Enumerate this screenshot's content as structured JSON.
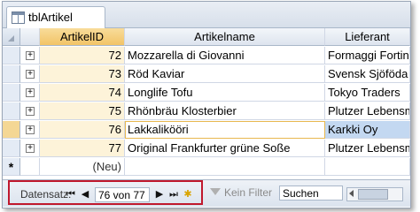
{
  "window": {
    "tab_title": "tblArtikel"
  },
  "columns": {
    "id": "ArtikelID",
    "name": "Artikelname",
    "lief": "Lieferant"
  },
  "rows": [
    {
      "id": "72",
      "name": "Mozzarella di Giovanni",
      "lief": "Formaggi Fortini"
    },
    {
      "id": "73",
      "name": "Röd Kaviar",
      "lief": "Svensk Sjöföda"
    },
    {
      "id": "74",
      "name": "Longlife Tofu",
      "lief": "Tokyo Traders"
    },
    {
      "id": "75",
      "name": "Rhönbräu Klosterbier",
      "lief": "Plutzer Lebensm"
    },
    {
      "id": "76",
      "name": "Lakkalikööri",
      "lief": "Karkki Oy"
    },
    {
      "id": "77",
      "name": "Original Frankfurter grüne Soße",
      "lief": "Plutzer Lebensm"
    }
  ],
  "new_row": {
    "marker": "*",
    "id": "(Neu)"
  },
  "current_row_index": 4,
  "navigation": {
    "label": "Datensatz:",
    "record": "76 von 77",
    "filter": "Kein Filter",
    "search_placeholder": "Suchen"
  }
}
